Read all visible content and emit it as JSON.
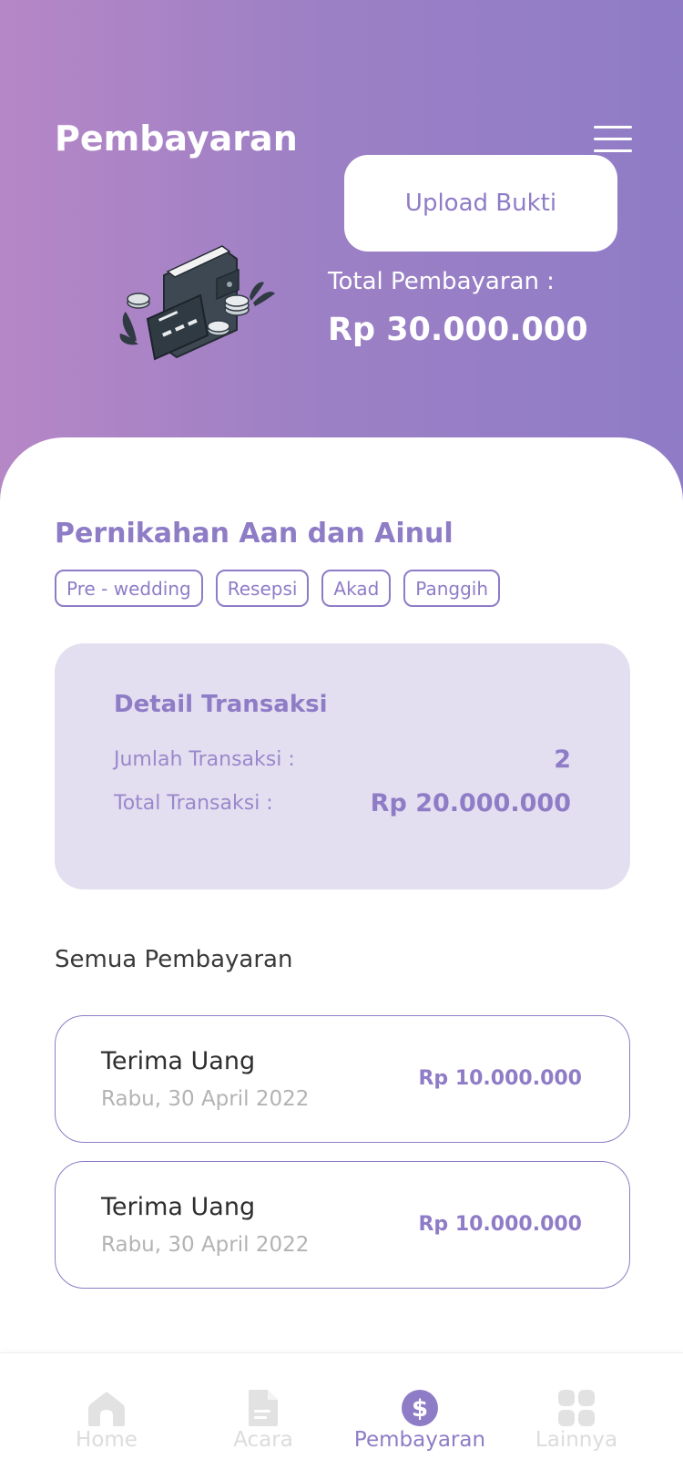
{
  "header": {
    "title": "Pembayaran",
    "menu_icon": "hamburger-menu-icon",
    "upload_button": "Upload Bukti",
    "illustration": "wallet-credit-card-coins-illustration",
    "total_label": "Total Pembayaran :",
    "total_value": "Rp 30.000.000"
  },
  "event": {
    "title": "Pernikahan Aan dan Ainul",
    "tags": [
      "Pre - wedding",
      "Resepsi",
      "Akad",
      "Panggih"
    ]
  },
  "detail": {
    "title": "Detail Transaksi",
    "count_label": "Jumlah Transaksi :",
    "count_value": "2",
    "total_label": "Total Transaksi :",
    "total_value": "Rp 20.000.000"
  },
  "payments": {
    "section_title": "Semua Pembayaran",
    "items": [
      {
        "name": "Terima Uang",
        "date": "Rabu, 30 April 2022",
        "amount": "Rp 10.000.000"
      },
      {
        "name": "Terima Uang",
        "date": "Rabu, 30 April 2022",
        "amount": "Rp 10.000.000"
      }
    ]
  },
  "nav": {
    "items": [
      {
        "label": "Home",
        "icon": "home-icon",
        "active": false
      },
      {
        "label": "Acara",
        "icon": "document-icon",
        "active": false
      },
      {
        "label": "Pembayaran",
        "icon": "dollar-icon",
        "active": true
      },
      {
        "label": "Lainnya",
        "icon": "grid-icon",
        "active": false
      }
    ]
  },
  "colors": {
    "accent": "#8f7cc6",
    "gradient_start": "#b687c6",
    "gradient_end": "#8f7cc6",
    "card_bg": "#e3dff0",
    "inactive_nav": "#dcdcdc"
  }
}
